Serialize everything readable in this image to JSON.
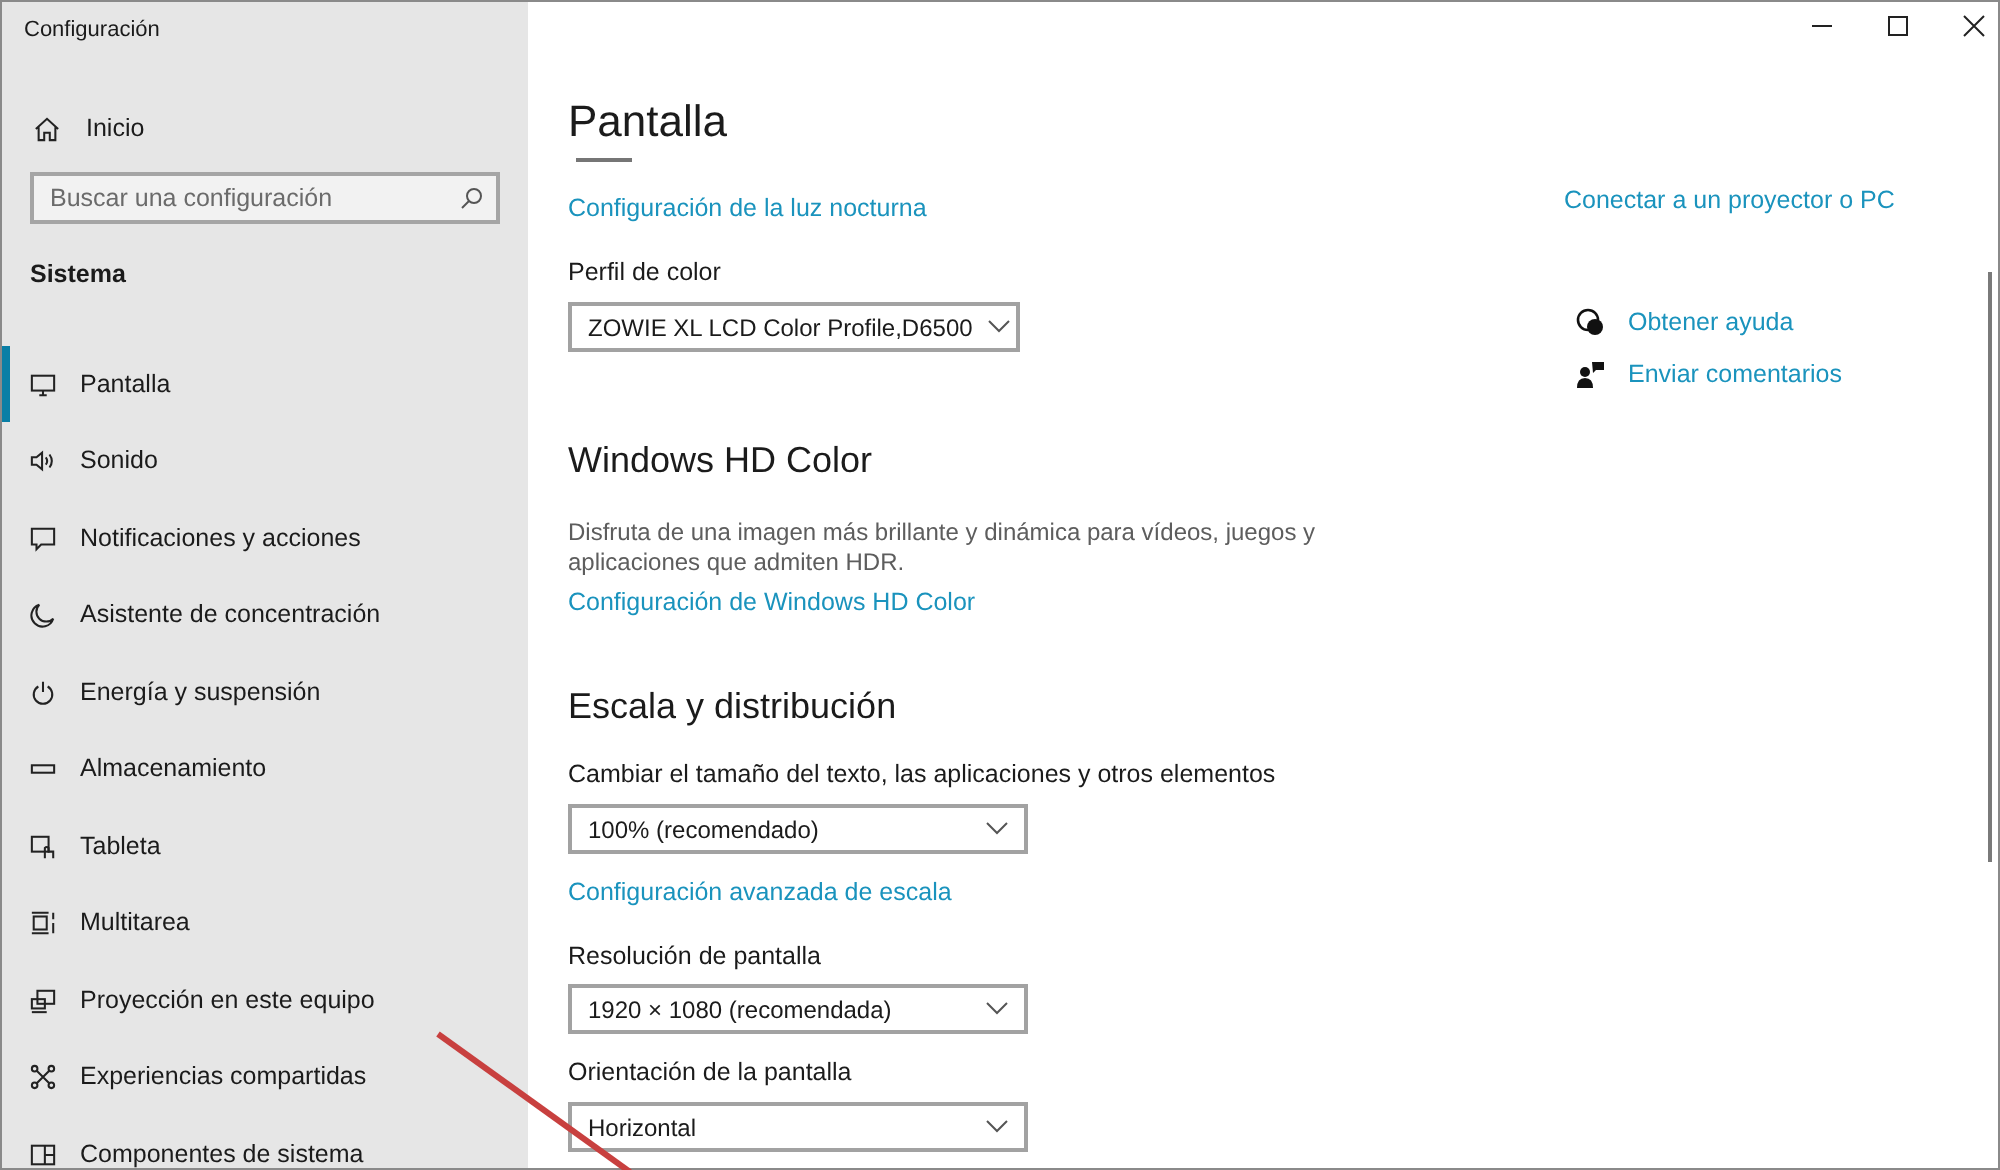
{
  "window": {
    "title": "Configuración"
  },
  "sidebar": {
    "home": "Inicio",
    "search": {
      "placeholder": "Buscar una configuración"
    },
    "section": "Sistema",
    "items": [
      {
        "label": "Pantalla",
        "selected": true
      },
      {
        "label": "Sonido",
        "selected": false
      },
      {
        "label": "Notificaciones y acciones",
        "selected": false
      },
      {
        "label": "Asistente de concentración",
        "selected": false
      },
      {
        "label": "Energía y suspensión",
        "selected": false
      },
      {
        "label": "Almacenamiento",
        "selected": false
      },
      {
        "label": "Tableta",
        "selected": false
      },
      {
        "label": "Multitarea",
        "selected": false
      },
      {
        "label": "Proyección en este equipo",
        "selected": false
      },
      {
        "label": "Experiencias compartidas",
        "selected": false
      },
      {
        "label": "Componentes de sistema",
        "selected": false
      }
    ]
  },
  "main": {
    "title": "Pantalla",
    "content": [
      {
        "kind": "link",
        "text": "Configuración de la luz nocturna"
      },
      {
        "kind": "label",
        "text": "Perfil de color"
      },
      {
        "kind": "dropdown",
        "value": "ZOWIE XL LCD Color Profile,D6500"
      },
      {
        "kind": "heading",
        "text": "Windows HD Color"
      },
      {
        "kind": "paragraph",
        "text": "Disfruta de una imagen más brillante y dinámica para vídeos, juegos y aplicaciones que admiten HDR."
      },
      {
        "kind": "link",
        "text": "Configuración de Windows HD Color"
      },
      {
        "kind": "heading",
        "text": "Escala y distribución"
      },
      {
        "kind": "label",
        "text": "Cambiar el tamaño del texto, las aplicaciones y otros elementos"
      },
      {
        "kind": "dropdown",
        "value": "100% (recomendado)"
      },
      {
        "kind": "link",
        "text": "Configuración avanzada de escala"
      },
      {
        "kind": "label",
        "text": "Resolución de pantalla"
      },
      {
        "kind": "dropdown",
        "value": "1920 × 1080 (recomendada)"
      },
      {
        "kind": "label",
        "text": "Orientación de la pantalla"
      },
      {
        "kind": "dropdown",
        "value": "Horizontal"
      }
    ]
  },
  "related": {
    "links": [
      "Conectar a un proyector o PC"
    ],
    "help": [
      {
        "label": "Obtener ayuda"
      },
      {
        "label": "Enviar comentarios"
      }
    ]
  }
}
